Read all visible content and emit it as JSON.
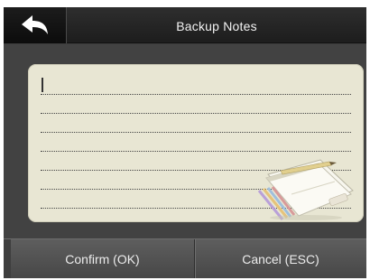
{
  "header": {
    "title": "Backup Notes",
    "back_icon": "back-arrow-icon"
  },
  "notepad": {
    "value": "",
    "illustration": "notepad-pencils-icon",
    "colors": {
      "paper": "#e8e6d3",
      "background": "#424242"
    }
  },
  "footer": {
    "confirm_label": "Confirm (OK)",
    "cancel_label": "Cancel (ESC)"
  }
}
